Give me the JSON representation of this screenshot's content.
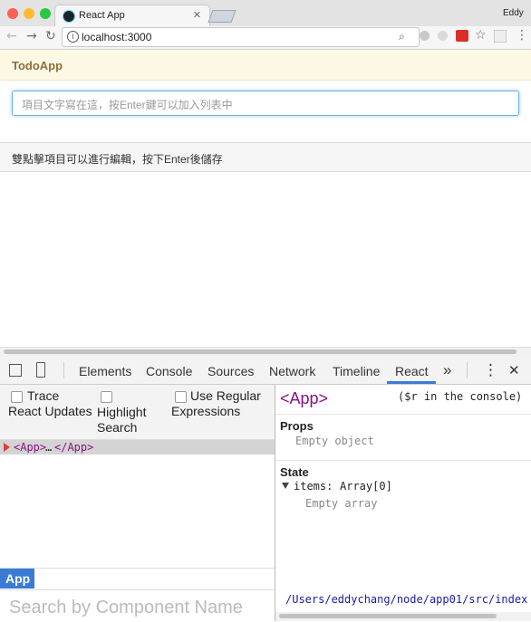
{
  "browser": {
    "tab_title": "React App",
    "tab_close": "×",
    "profile_name": "Eddy",
    "url": "localhost:3000",
    "nav": {
      "back": "←",
      "forward": "→",
      "reload": "↻"
    },
    "toolbar_icons": [
      "info-icon",
      "zoom-icon",
      "extension-icon",
      "extension-icon",
      "extension-badge-icon",
      "bookmark-star-icon",
      "extension-icon",
      "menu-icon"
    ],
    "colors": {
      "close": "#ff5f57",
      "minimize": "#febc2e",
      "maximize": "#28c840"
    }
  },
  "app": {
    "title": "TodoApp",
    "input_placeholder": "項目文字寫在這，按Enter鍵可以加入列表中",
    "footer_note": "雙點擊項目可以進行編輯，按下Enter後儲存"
  },
  "devtools": {
    "tabs": [
      "Elements",
      "Console",
      "Sources",
      "Network",
      "Timeline",
      "React"
    ],
    "active_tab": "React",
    "more": "»",
    "close": "✕",
    "options": {
      "trace_react_updates": "Trace React Updates",
      "highlight_search": "Highlight Search",
      "use_regular_expressions": "Use Regular Expressions"
    },
    "tree": {
      "open_tag": "<App>",
      "ellipsis": "…",
      "close_tag": "</App>"
    },
    "breadcrumb": "App",
    "search_placeholder": "Search by Component Name",
    "inspector": {
      "component": "<App>",
      "console_hint": "($r in the console)",
      "props_label": "Props",
      "props_empty": "Empty object",
      "state_label": "State",
      "state_key": "items:",
      "state_value": "Array[0]",
      "state_empty": "Empty array",
      "source_path": "/Users/eddychang/node/app01/src/index"
    },
    "colors": {
      "accent": "#3a7bd5",
      "tag": "#881280"
    }
  }
}
